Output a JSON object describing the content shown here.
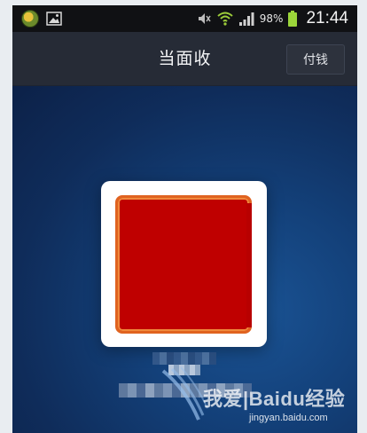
{
  "status_bar": {
    "battery_percent": "98%",
    "time": "21:44",
    "icons": [
      "app-icon",
      "gallery-icon",
      "mute-icon",
      "wifi-icon",
      "signal-icon",
      "battery-icon"
    ]
  },
  "header": {
    "title": "当面收",
    "pay_button_label": "付钱"
  },
  "main": {
    "qr_code_color": "#bf0000",
    "qr_border_color": "#e06320"
  },
  "watermark": {
    "text": "我爱|Baidu经验",
    "url": "jingyan.baidu.com"
  },
  "colors": {
    "header_bg": "#262b36",
    "status_bg": "#101114",
    "main_bg": "#134079"
  }
}
